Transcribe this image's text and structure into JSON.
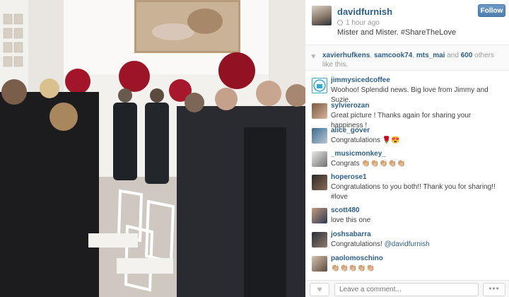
{
  "post": {
    "username": "davidfurnish",
    "time": "1 hour ago",
    "caption": "Mister and Mister. #ShareTheLove",
    "follow_label": "Follow"
  },
  "likes": {
    "names": [
      "xavierhufkens",
      "samcook74",
      "mts_mai"
    ],
    "separator": ", ",
    "and_text": " and ",
    "count_text": "600",
    "suffix": " others like this."
  },
  "comments": [
    {
      "user": "jimmysicedcoffee",
      "text": "Woohoo! Splendid news. Big love from Jimmy and Suzie.",
      "avatar": "logo"
    },
    {
      "user": "sylvierozan",
      "text": "Great picture ! Thanks again for sharing your happiness !",
      "avatar": "photo"
    },
    {
      "user": "alice_gover",
      "text": "Congratulations 🌹😍",
      "avatar": "photo"
    },
    {
      "user": "_musicmonkey_",
      "text": "Congrats 👏🏼👏🏼👏🏼👏🏼👏🏼",
      "avatar": "photo"
    },
    {
      "user": "hoperose1",
      "text": "Congratulations to you both!! Thank you for sharing!! #love",
      "avatar": "photo"
    },
    {
      "user": "scott480",
      "text": "love this one",
      "avatar": "photo"
    },
    {
      "user": "joshsabarra",
      "text": "Congratulations! ",
      "mention": "@davidfurnish",
      "avatar": "photo"
    },
    {
      "user": "paolomoschino",
      "text": "👏🏼👏🏼👏🏼👏🏼👏🏼",
      "avatar": "photo"
    }
  ],
  "footer": {
    "comment_placeholder": "Leave a comment...",
    "more_label": "•••"
  },
  "colors": {
    "link": "#2d5f8a",
    "follow_button": "#5a87b8",
    "muted": "#999999"
  },
  "icons": {
    "time": "clock-icon",
    "likes": "heart-icon",
    "like_button": "heart-icon",
    "more": "ellipsis-icon"
  }
}
